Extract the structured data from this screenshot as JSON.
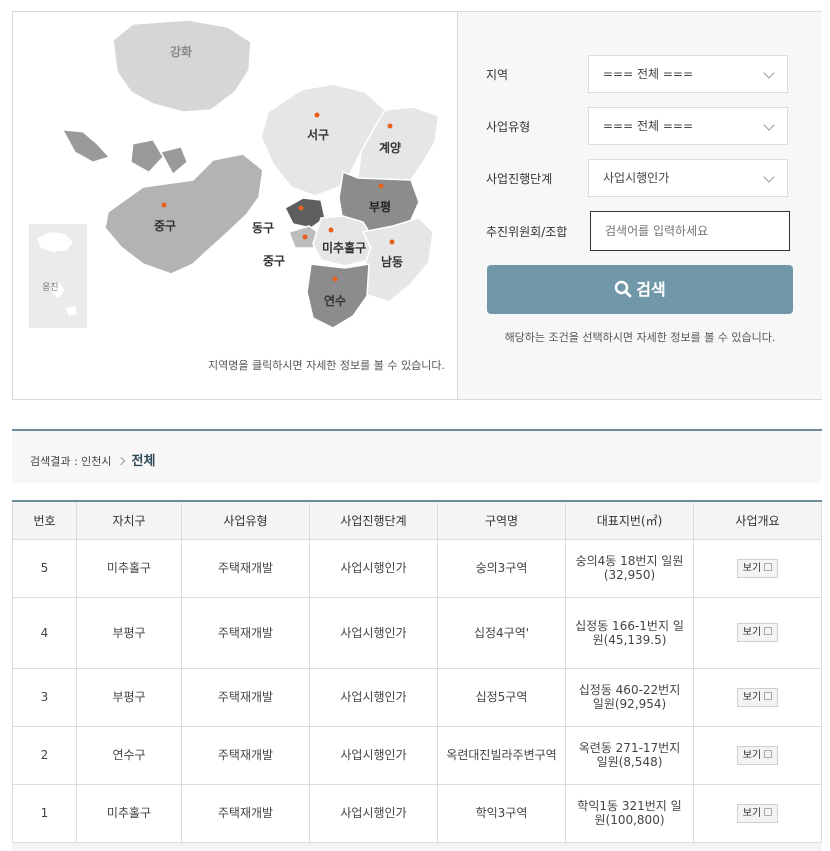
{
  "map": {
    "districts": [
      {
        "id": "ganghwa",
        "label": "강화"
      },
      {
        "id": "seo",
        "label": "서구"
      },
      {
        "id": "gyeyang",
        "label": "계양"
      },
      {
        "id": "jung-big",
        "label": "중구"
      },
      {
        "id": "bupyeong",
        "label": "부평"
      },
      {
        "id": "dong",
        "label": "동구"
      },
      {
        "id": "michuhol",
        "label": "미추홀구"
      },
      {
        "id": "jung-small",
        "label": "중구"
      },
      {
        "id": "namdong",
        "label": "남동"
      },
      {
        "id": "yeonsu",
        "label": "연수"
      },
      {
        "id": "ongjin",
        "label": "옹진"
      }
    ],
    "note": "지역명을 클릭하시면 자세한 정보를 볼 수 있습니다.",
    "colors": {
      "light": "#e6e6e6",
      "mid": "#bdbdbd",
      "dark": "#8c8c8c",
      "darkest": "#5e5e5e",
      "dot": "#e8601c"
    }
  },
  "form": {
    "region_label": "지역",
    "region_value": "=== 전체 ===",
    "type_label": "사업유형",
    "type_value": "=== 전체 ===",
    "stage_label": "사업진행단계",
    "stage_value": "사업시행인가",
    "committee_label": "추진위원회/조합",
    "committee_placeholder": "검색어를 입력하세요",
    "search_label": "검색",
    "note": "해당하는 조건을 선택하시면 자세한 정보를 볼 수 있습니다."
  },
  "result": {
    "prefix": "검색결과 : 인천시",
    "current": "전체"
  },
  "table": {
    "headers": [
      "번호",
      "자치구",
      "사업유형",
      "사업진행단계",
      "구역명",
      "대표지번(㎡)",
      "사업개요"
    ],
    "view_label": "보기",
    "rows": [
      {
        "no": "5",
        "district": "미추홀구",
        "type": "주택재개발",
        "stage": "사업시행인가",
        "zone": "숭의3구역",
        "lot": "숭의4동 18번지 일원(32,950)"
      },
      {
        "no": "4",
        "district": "부평구",
        "type": "주택재개발",
        "stage": "사업시행인가",
        "zone": "십정4구역'",
        "lot": "십정동 166-1번지 일원(45,139.5)"
      },
      {
        "no": "3",
        "district": "부평구",
        "type": "주택재개발",
        "stage": "사업시행인가",
        "zone": "십정5구역",
        "lot": "십정동 460-22번지 일원(92,954)"
      },
      {
        "no": "2",
        "district": "연수구",
        "type": "주택재개발",
        "stage": "사업시행인가",
        "zone": "옥련대진빌라주변구역",
        "lot": "옥련동 271-17번지 일원(8,548)"
      },
      {
        "no": "1",
        "district": "미추홀구",
        "type": "주택재개발",
        "stage": "사업시행인가",
        "zone": "학익3구역",
        "lot": "학익1동 321번지 일원(100,800)"
      }
    ]
  }
}
